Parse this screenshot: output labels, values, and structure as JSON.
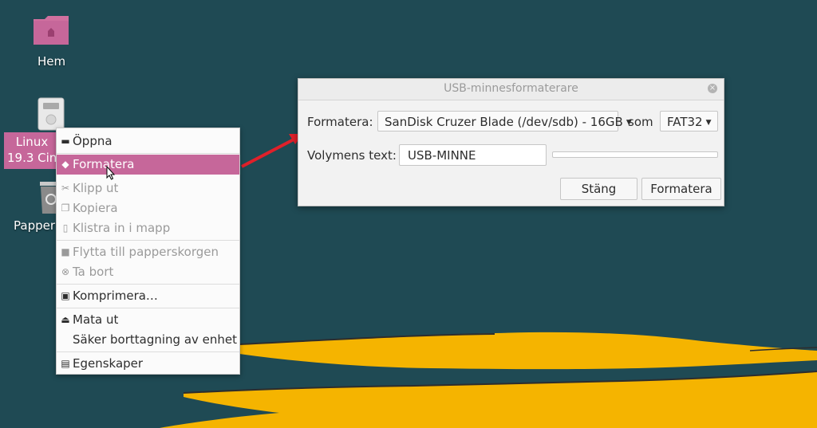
{
  "desktop": {
    "home_label": "Hem",
    "drive_label_line1": "Linux",
    "drive_label_line2": "19.3 Cin",
    "trash_label": "Papper"
  },
  "context_menu": {
    "items": [
      {
        "label": "Öppna",
        "icon": "folder-icon",
        "enabled": true
      },
      {
        "label": "Formatera",
        "icon": "eraser-icon",
        "enabled": true,
        "highlighted": true
      },
      {
        "label": "Klipp ut",
        "icon": "scissors-icon",
        "enabled": false
      },
      {
        "label": "Kopiera",
        "icon": "copy-icon",
        "enabled": false
      },
      {
        "label": "Klistra in i mapp",
        "icon": "paste-icon",
        "enabled": false
      },
      {
        "label": "Flytta till papperskorgen",
        "icon": "trash-icon",
        "enabled": false
      },
      {
        "label": "Ta bort",
        "icon": "delete-icon",
        "enabled": false
      },
      {
        "label": "Komprimera…",
        "icon": "archive-icon",
        "enabled": true
      },
      {
        "label": "Mata ut",
        "icon": "eject-icon",
        "enabled": true
      },
      {
        "label": "Säker borttagning av enhet",
        "icon": "",
        "enabled": true
      },
      {
        "label": "Egenskaper",
        "icon": "properties-icon",
        "enabled": true
      }
    ]
  },
  "dialog": {
    "title": "USB-minnesformaterare",
    "format_label": "Formatera:",
    "device_value": "SanDisk Cruzer Blade (/dev/sdb) - 16GB",
    "as_label": "som",
    "filesystem_value": "FAT32",
    "volume_label": "Volymens text:",
    "volume_value": "USB-MINNE",
    "progress": 0,
    "close_button": "Stäng",
    "format_button": "Formatera"
  },
  "colors": {
    "desktop_bg": "#1f4a54",
    "accent": "#c6679a",
    "wave": "#f5b400",
    "arrow": "#e0202a"
  }
}
